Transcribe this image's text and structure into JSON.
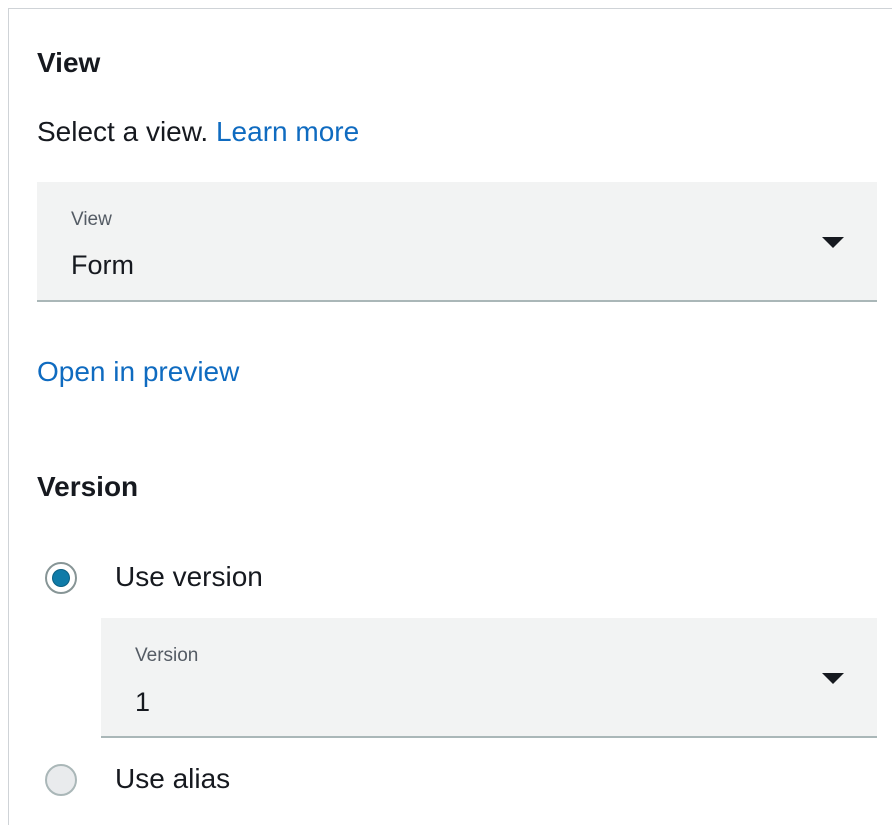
{
  "view_section": {
    "title": "View",
    "description": "Select a view.",
    "learn_more_link": "Learn more",
    "select": {
      "label": "View",
      "value": "Form"
    },
    "open_preview_link": "Open in preview"
  },
  "version_section": {
    "title": "Version",
    "options": [
      {
        "label": "Use version",
        "checked": true
      },
      {
        "label": "Use alias",
        "checked": false
      }
    ],
    "version_select": {
      "label": "Version",
      "value": "1"
    }
  },
  "colors": {
    "link": "#0f6bc0",
    "radio_selected": "#0f7ba8",
    "select_bg": "#f2f3f3"
  },
  "icons": {
    "dropdown": "caret-down-icon",
    "radio_selected": "radio-checked-icon",
    "radio_unselected": "radio-unchecked-icon"
  }
}
